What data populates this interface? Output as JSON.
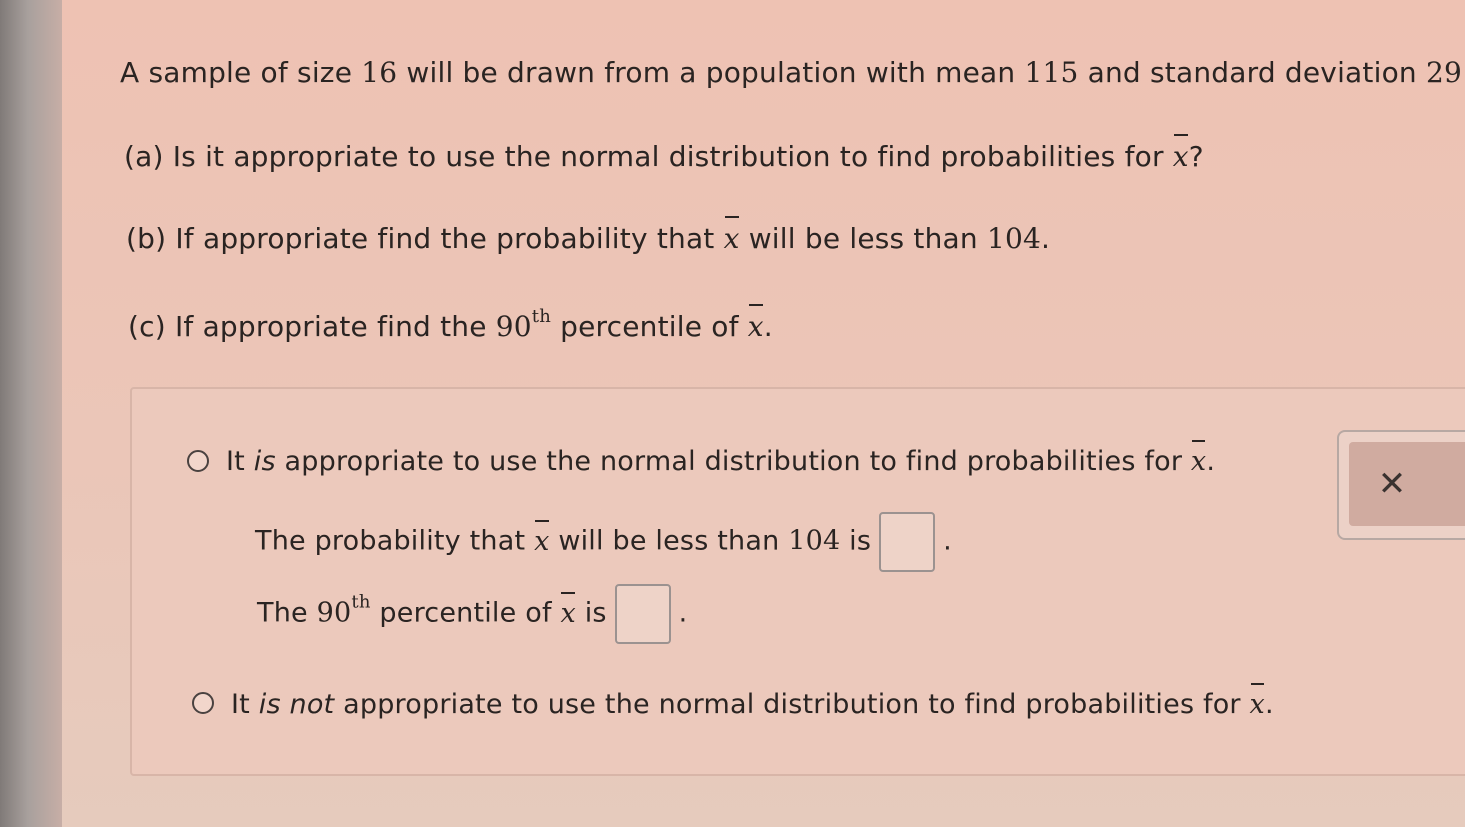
{
  "question": {
    "intro": {
      "prefix": "A sample of size",
      "n": "16",
      "mid1": "will be drawn from a population with mean",
      "mean": "115",
      "mid2": "and standard deviation",
      "sd": "29",
      "end": "."
    },
    "part_a": {
      "label": "(a)",
      "text": "Is it appropriate to use the normal distribution to find probabilities for",
      "var": "x",
      "end": "?"
    },
    "part_b": {
      "label": "(b)",
      "text1": "If appropriate find the probability that",
      "var": "x",
      "text2": "will be less than",
      "value": "104",
      "end": "."
    },
    "part_c": {
      "label": "(c)",
      "text1": "If appropriate find the",
      "num": "90",
      "sup": "th",
      "text2": "percentile of",
      "var": "x",
      "end": "."
    }
  },
  "answers": {
    "option1": {
      "pre": "It",
      "em": "is",
      "post": "appropriate to use the normal distribution to find probabilities for",
      "var": "x",
      "end": "."
    },
    "prob_line": {
      "text1": "The probability that",
      "var": "x",
      "text2": "will be less than",
      "value": "104",
      "text3": "is",
      "end": "."
    },
    "pct_line": {
      "text1": "The",
      "num": "90",
      "sup": "th",
      "text2": "percentile of",
      "var": "x",
      "text3": "is",
      "end": "."
    },
    "option2": {
      "pre": "It",
      "em": "is not",
      "post": "appropriate to use the normal distribution to find probabilities for",
      "var": "x",
      "end": "."
    }
  },
  "clear_button": {
    "icon": "close-icon",
    "glyph": "✕"
  }
}
